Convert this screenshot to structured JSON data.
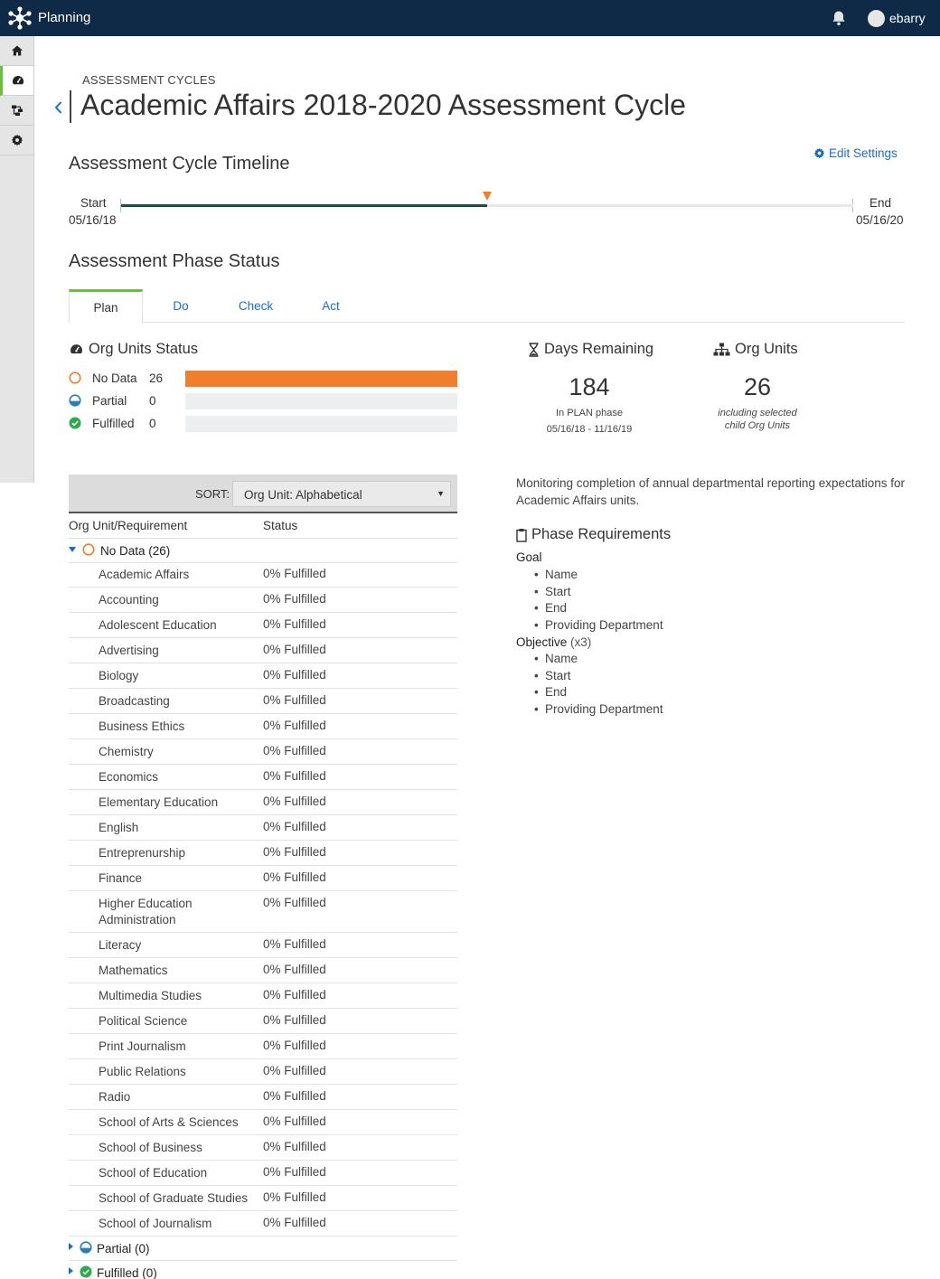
{
  "topbar": {
    "app_title": "Planning",
    "username": "ebarry"
  },
  "rail": {
    "items": [
      "home-icon",
      "dashboard-icon",
      "hierarchy-icon",
      "gear-icon"
    ],
    "active_index": 1
  },
  "header": {
    "breadcrumb": "ASSESSMENT CYCLES",
    "title": "Academic Affairs 2018-2020 Assessment Cycle"
  },
  "timeline": {
    "heading": "Assessment Cycle Timeline",
    "edit_settings": "Edit Settings",
    "start_label": "Start",
    "start_date": "05/16/18",
    "end_label": "End",
    "end_date": "05/16/20",
    "progress": 0.5
  },
  "phase": {
    "heading": "Assessment Phase Status",
    "tabs": [
      {
        "label": "Plan",
        "active": true
      },
      {
        "label": "Do",
        "active": false
      },
      {
        "label": "Check",
        "active": false
      },
      {
        "label": "Act",
        "active": false
      }
    ]
  },
  "org_status": {
    "title": "Org Units Status",
    "total": 26,
    "rows": [
      {
        "label": "No Data",
        "count": "26",
        "fraction": 1.0
      },
      {
        "label": "Partial",
        "count": "0",
        "fraction": 0
      },
      {
        "label": "Fulfilled",
        "count": "0",
        "fraction": 0
      }
    ]
  },
  "days_remaining": {
    "title": "Days Remaining",
    "value": "184",
    "note1": "In PLAN phase",
    "note2": "05/16/18 - 11/16/19"
  },
  "org_units": {
    "title": "Org Units",
    "value": "26",
    "note1": "including selected",
    "note2": "child Org Units"
  },
  "table": {
    "sort_label": "SORT:",
    "sort_value": "Org Unit: Alphabetical",
    "col1": "Org Unit/Requirement",
    "col2": "Status",
    "group_nodata": "No Data (26)",
    "group_partial": "Partial (0)",
    "group_fulfilled": "Fulfilled (0)",
    "rows": [
      {
        "name": "Academic Affairs",
        "status": "0% Fulfilled"
      },
      {
        "name": "Accounting",
        "status": "0% Fulfilled"
      },
      {
        "name": "Adolescent Education",
        "status": "0% Fulfilled"
      },
      {
        "name": "Advertising",
        "status": "0% Fulfilled"
      },
      {
        "name": "Biology",
        "status": "0% Fulfilled"
      },
      {
        "name": "Broadcasting",
        "status": "0% Fulfilled"
      },
      {
        "name": "Business Ethics",
        "status": "0% Fulfilled"
      },
      {
        "name": "Chemistry",
        "status": "0% Fulfilled"
      },
      {
        "name": "Economics",
        "status": "0% Fulfilled"
      },
      {
        "name": "Elementary Education",
        "status": "0% Fulfilled"
      },
      {
        "name": "English",
        "status": "0% Fulfilled"
      },
      {
        "name": "Entreprenurship",
        "status": "0% Fulfilled"
      },
      {
        "name": "Finance",
        "status": "0% Fulfilled"
      },
      {
        "name": "Higher Education Administration",
        "status": "0% Fulfilled"
      },
      {
        "name": "Literacy",
        "status": "0% Fulfilled"
      },
      {
        "name": "Mathematics",
        "status": "0% Fulfilled"
      },
      {
        "name": "Multimedia Studies",
        "status": "0% Fulfilled"
      },
      {
        "name": "Political Science",
        "status": "0% Fulfilled"
      },
      {
        "name": "Print Journalism",
        "status": "0% Fulfilled"
      },
      {
        "name": "Public Relations",
        "status": "0% Fulfilled"
      },
      {
        "name": "Radio",
        "status": "0% Fulfilled"
      },
      {
        "name": "School of Arts & Sciences",
        "status": "0% Fulfilled"
      },
      {
        "name": "School of Business",
        "status": "0% Fulfilled"
      },
      {
        "name": "School of Education",
        "status": "0% Fulfilled"
      },
      {
        "name": "School of Graduate Studies",
        "status": "0% Fulfilled"
      },
      {
        "name": "School of Journalism",
        "status": "0% Fulfilled"
      }
    ]
  },
  "description": "Monitoring completion of annual departmental reporting expectations for Academic Affairs units.",
  "requirements": {
    "title": "Phase Requirements",
    "goal_label": "Goal",
    "goal_items": [
      "Name",
      "Start",
      "End",
      "Providing Department"
    ],
    "objective_label": "Objective",
    "objective_count": "(x3)",
    "objective_items": [
      "Name",
      "Start",
      "End",
      "Providing Department"
    ]
  },
  "colors": {
    "topbar": "#0e2a47",
    "accent_green": "#6bbf3e",
    "nodata_orange": "#ef7f2c",
    "link_blue": "#1a6ec0",
    "partial_blue": "#2a7fb0",
    "fulfilled_green": "#2bab4b"
  }
}
